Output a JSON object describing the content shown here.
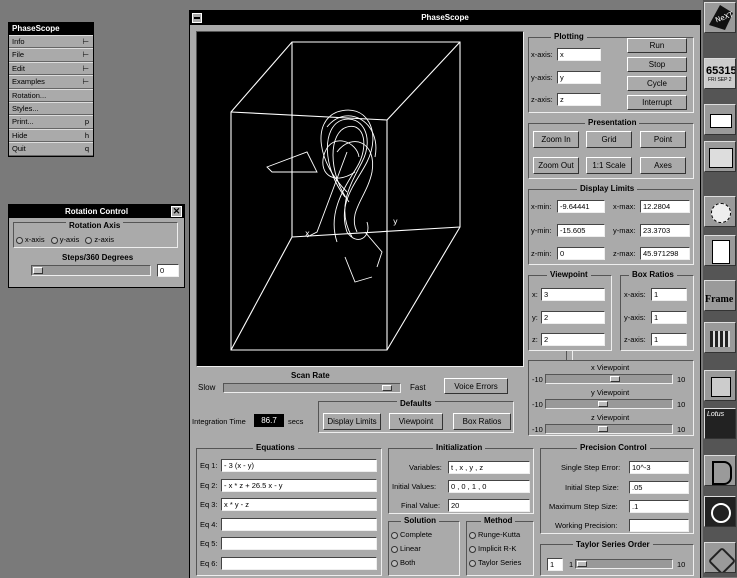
{
  "menu": {
    "title": "PhaseScope",
    "items": [
      {
        "label": "Info",
        "key": "⊢"
      },
      {
        "label": "File",
        "key": "⊢"
      },
      {
        "label": "Edit",
        "key": "⊢"
      },
      {
        "label": "Examples",
        "key": "⊢"
      },
      {
        "label": "Rotation...",
        "key": ""
      },
      {
        "label": "Styles...",
        "key": ""
      },
      {
        "label": "Print...",
        "key": "p"
      },
      {
        "label": "Hide",
        "key": "h"
      },
      {
        "label": "Quit",
        "key": "q"
      }
    ]
  },
  "rotation": {
    "title": "Rotation Control",
    "axis_title": "Rotation Axis",
    "axes": [
      "x-axis",
      "y-axis",
      "z-axis"
    ],
    "steps_title": "Steps/360 Degrees",
    "steps_value": "0",
    "steps_level": 0.0
  },
  "window": {
    "title": "PhaseScope"
  },
  "plot": {
    "x_label": "x",
    "y_label": "y"
  },
  "plotting": {
    "title": "Plotting",
    "x_label": "x-axis:",
    "x_value": "x",
    "y_label": "y-axis:",
    "y_value": "y",
    "z_label": "z-axis:",
    "z_value": "z",
    "run": "Run",
    "stop": "Stop",
    "cycle": "Cycle",
    "interrupt": "Interrupt"
  },
  "presentation": {
    "title": "Presentation",
    "zoom_in": "Zoom In",
    "grid": "Grid",
    "point": "Point",
    "zoom_out": "Zoom Out",
    "scale": "1:1 Scale",
    "axes": "Axes"
  },
  "limits": {
    "title": "Display Limits",
    "xmin_label": "x-min:",
    "xmin": "-9.64441",
    "xmax_label": "x-max:",
    "xmax": "12.2804",
    "ymin_label": "y-min:",
    "ymin": "-15.605",
    "ymax_label": "y-max:",
    "ymax": "23.3703",
    "zmin_label": "z-min:",
    "zmin": "0",
    "zmax_label": "z-max:",
    "zmax": "45.971298"
  },
  "viewpoint": {
    "title": "Viewpoint",
    "x_label": "x:",
    "x": "3",
    "y_label": "y:",
    "y": "2",
    "z_label": "z:",
    "z": "2"
  },
  "box_ratios": {
    "title": "Box Ratios",
    "x_label": "x-axis:",
    "x": "1",
    "y_label": "y-axis:",
    "y": "1",
    "z_label": "z-axis:",
    "z": "1"
  },
  "vp_sliders": {
    "x_title": "x Viewpoint",
    "y_title": "y Viewpoint",
    "z_title": "z Viewpoint",
    "min": "-10",
    "max": "10",
    "x_level": 0.55,
    "y_level": 0.45,
    "z_level": 0.45
  },
  "scan": {
    "title": "Scan Rate",
    "slow": "Slow",
    "fast": "Fast",
    "level": 0.96,
    "voice_errors": "Voice Errors",
    "integration_label": "Integration Time",
    "integration_value": "86.7",
    "secs": "secs"
  },
  "defaults": {
    "title": "Defaults",
    "display_limits": "Display Limits",
    "viewpoint": "Viewpoint",
    "box_ratios": "Box Ratios"
  },
  "equations": {
    "title": "Equations",
    "rows": [
      {
        "label": "Eq 1:",
        "value": "- 3 (x - y)"
      },
      {
        "label": "Eq 2:",
        "value": "- x * z + 26.5 x - y"
      },
      {
        "label": "Eq 3:",
        "value": "x * y - z"
      },
      {
        "label": "Eq 4:",
        "value": ""
      },
      {
        "label": "Eq 5:",
        "value": ""
      },
      {
        "label": "Eq 6:",
        "value": ""
      }
    ]
  },
  "init": {
    "title": "Initialization",
    "vars_label": "Variables:",
    "vars": "t , x , y , z",
    "iv_label": "Initial Values:",
    "iv": "0 , 0 , 1 , 0",
    "fv_label": "Final Value:",
    "fv": "20"
  },
  "solution": {
    "title": "Solution",
    "options": [
      "Complete",
      "Linear",
      "Both"
    ]
  },
  "method": {
    "title": "Method",
    "options": [
      "Runge-Kutta",
      "Implicit R-K",
      "Taylor Series"
    ]
  },
  "precision": {
    "title": "Precision Control",
    "sse_label": "Single Step Error:",
    "sse": "10^-3",
    "iss_label": "Initial Step Size:",
    "iss": ".05",
    "mss_label": "Maximum Step Size:",
    "mss": ".1",
    "wp_label": "Working Precision:",
    "wp": ""
  },
  "taylor": {
    "title": "Taylor Series Order",
    "value": "1",
    "min": "1",
    "max": "10",
    "level": 0.0
  },
  "dock": {
    "digits": "65315",
    "date": "FRI SEP 2",
    "frame": "Frame",
    "lotus": "Lotus"
  }
}
